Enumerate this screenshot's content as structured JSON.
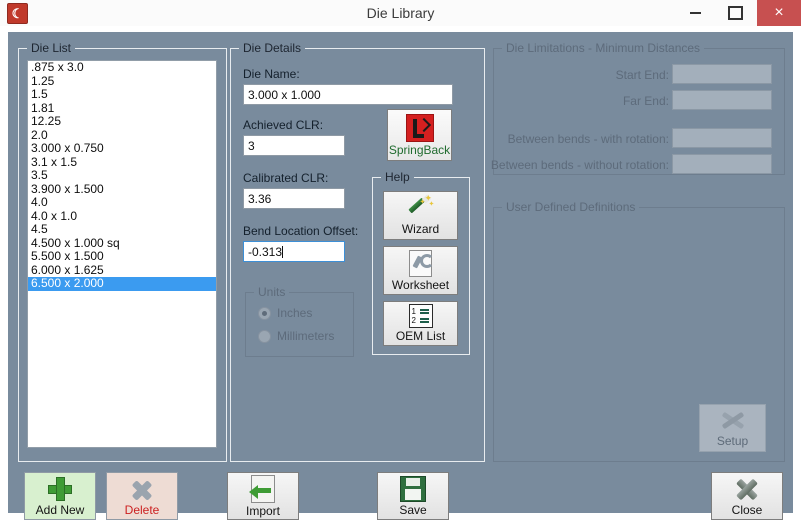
{
  "window": {
    "title": "Die Library",
    "app_icon": "app-icon",
    "controls": {
      "minimize": "minimize-button",
      "maximize": "maximize-button",
      "close": "close-button",
      "close_glyph": "×"
    }
  },
  "die_list": {
    "legend": "Die List",
    "items": [
      ".875 x 3.0",
      "1.25",
      "1.5",
      "1.81",
      "12.25",
      "2.0",
      "3.000 x 0.750",
      "3.1 x 1.5",
      "3.5",
      "3.900 x 1.500",
      "4.0",
      "4.0 x 1.0",
      "4.5",
      "4.500 x 1.000 sq",
      "5.500 x 1.500",
      "6.000 x 1.625",
      "6.500 x 2.000"
    ],
    "selected_index": 16,
    "selected_value": "6.500 x 2.000"
  },
  "die_details": {
    "legend": "Die Details",
    "die_name_label": "Die Name:",
    "die_name_value": "3.000 x 1.000",
    "achieved_clr_label": "Achieved CLR:",
    "achieved_clr_value": "3",
    "calibrated_clr_label": "Calibrated CLR:",
    "calibrated_clr_value": "3.36",
    "bend_offset_label": "Bend Location Offset:",
    "bend_offset_value": "-0.313",
    "springback_label": "SpringBack",
    "units": {
      "legend": "Units",
      "inches_label": "Inches",
      "millimeters_label": "Millimeters",
      "selected": "Inches"
    },
    "help": {
      "legend": "Help",
      "wizard_label": "Wizard",
      "worksheet_label": "Worksheet",
      "oem_list_label": "OEM List",
      "oem_icon_line1": "1",
      "oem_icon_line2": "2"
    }
  },
  "die_limitations": {
    "legend": "Die Limitations - Minimum Distances",
    "fields": [
      {
        "label": "Start End:",
        "value": ""
      },
      {
        "label": "Far End:",
        "value": ""
      },
      {
        "label": "Between bends - with rotation:",
        "value": ""
      },
      {
        "label": "Between bends - without rotation:",
        "value": ""
      }
    ]
  },
  "user_defined": {
    "legend": "User Defined Definitions",
    "setup_label": "Setup"
  },
  "toolbar": {
    "add_new_label": "Add New",
    "delete_label": "Delete",
    "import_label": "Import",
    "save_label": "Save",
    "close_label": "Close"
  },
  "colors": {
    "window_background": "#798b9d",
    "selection": "#3b9bf0",
    "close_button": "#c75050",
    "add_new_background": "#d8f0cf",
    "delete_background": "#eedcd4",
    "delete_text": "#cc1f1f",
    "springback_text": "#1f6b2e"
  }
}
